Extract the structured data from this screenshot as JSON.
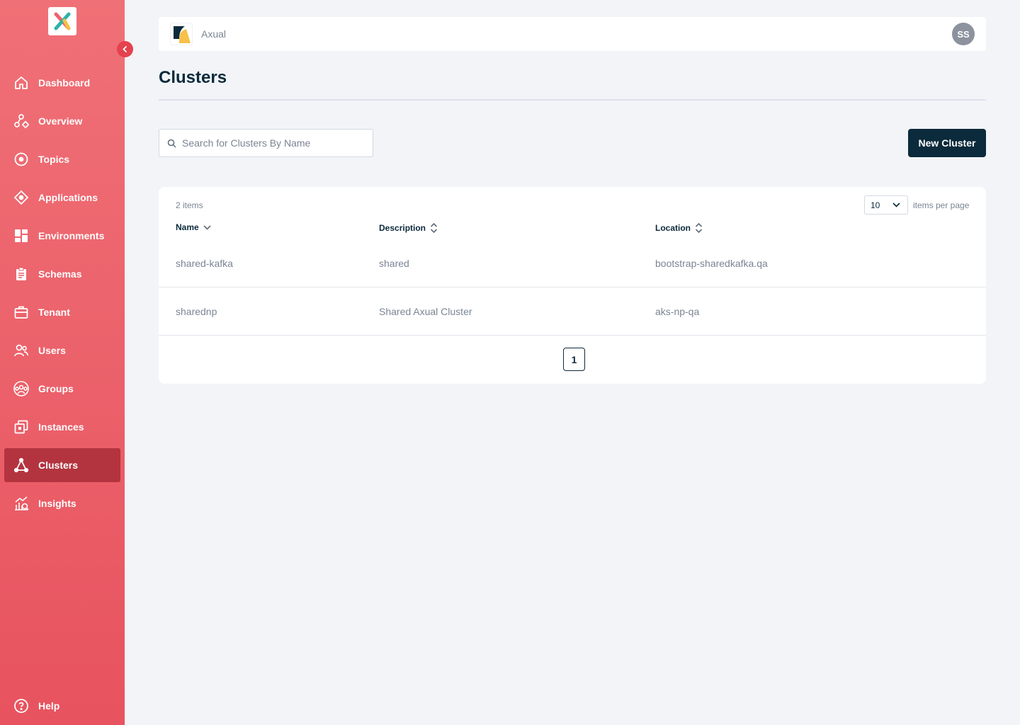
{
  "brand": {
    "accent": "#e7535f",
    "active": "#b3343f",
    "dark": "#0b2a3b"
  },
  "sidebar": {
    "items": [
      {
        "label": "Dashboard",
        "icon": "home-icon"
      },
      {
        "label": "Overview",
        "icon": "overview-icon"
      },
      {
        "label": "Topics",
        "icon": "topic-icon"
      },
      {
        "label": "Applications",
        "icon": "application-icon"
      },
      {
        "label": "Environments",
        "icon": "grid-icon"
      },
      {
        "label": "Schemas",
        "icon": "clipboard-icon"
      },
      {
        "label": "Tenant",
        "icon": "briefcase-icon"
      },
      {
        "label": "Users",
        "icon": "users-icon"
      },
      {
        "label": "Groups",
        "icon": "groups-icon"
      },
      {
        "label": "Instances",
        "icon": "instances-icon"
      },
      {
        "label": "Clusters",
        "icon": "cluster-icon",
        "active": true
      },
      {
        "label": "Insights",
        "icon": "insights-icon"
      }
    ],
    "help": {
      "label": "Help",
      "icon": "help-icon"
    }
  },
  "header": {
    "org_name": "Axual",
    "avatar_initials": "SS"
  },
  "page": {
    "title": "Clusters"
  },
  "search": {
    "placeholder": "Search for Clusters By Name"
  },
  "actions": {
    "new_cluster": "New Cluster"
  },
  "table": {
    "count_label": "2 items",
    "per_page_value": "10",
    "per_page_label": "items per page",
    "columns": [
      "Name",
      "Description",
      "Location"
    ],
    "rows": [
      {
        "name": "shared-kafka",
        "description": "shared",
        "location": "bootstrap-sharedkafka.qa"
      },
      {
        "name": "sharednp",
        "description": "Shared Axual Cluster",
        "location": "aks-np-qa"
      }
    ],
    "current_page": "1"
  }
}
